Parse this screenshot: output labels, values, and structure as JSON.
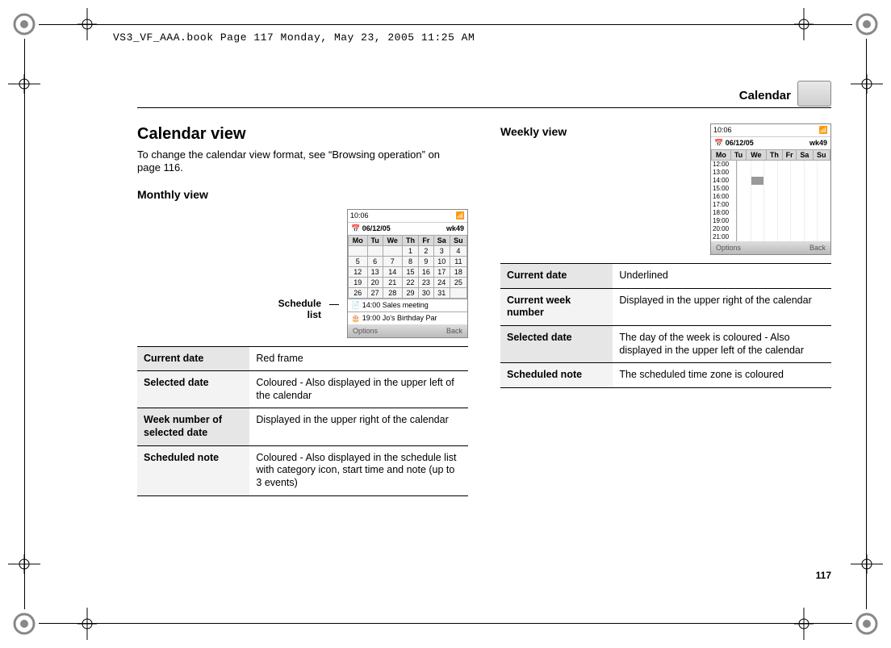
{
  "header_line": "VS3_VF_AAA.book  Page 117  Monday, May 23, 2005  11:25 AM",
  "running_head": "Calendar",
  "page_number": "117",
  "left": {
    "h2": "Calendar view",
    "intro": "To change the calendar view format, see “Browsing operation” on page 116.",
    "h3": "Monthly view",
    "callout": "Schedule\nlist",
    "phone": {
      "clock": "10:06",
      "date": "06/12/05",
      "week": "wk49",
      "days": [
        "Mo",
        "Tu",
        "We",
        "Th",
        "Fr",
        "Sa",
        "Su"
      ],
      "grid": [
        [
          "",
          "",
          "",
          "1",
          "2",
          "3",
          "4"
        ],
        [
          "5",
          "6",
          "7",
          "8",
          "9",
          "10",
          "11"
        ],
        [
          "12",
          "13",
          "14",
          "15",
          "16",
          "17",
          "18"
        ],
        [
          "19",
          "20",
          "21",
          "22",
          "23",
          "24",
          "25"
        ],
        [
          "26",
          "27",
          "28",
          "29",
          "30",
          "31",
          ""
        ]
      ],
      "sched1": "14:00  Sales meeting",
      "sched2": "19:00  Jo's Birthday Par",
      "soft_left": "Options",
      "soft_right": "Back"
    },
    "table": [
      {
        "label": "Current date",
        "value": "Red frame"
      },
      {
        "label": "Selected date",
        "value": "Coloured - Also displayed in the upper left of the calendar"
      },
      {
        "label": "Week number of selected date",
        "value": "Displayed in the upper right of the calendar"
      },
      {
        "label": "Scheduled note",
        "value": "Coloured - Also displayed in the schedule list with category icon, start time and note (up to 3 events)"
      }
    ]
  },
  "right": {
    "h3": "Weekly view",
    "phone": {
      "clock": "10:06",
      "date": "06/12/05",
      "week": "wk49",
      "days": [
        "Mo",
        "Tu",
        "We",
        "Th",
        "Fr",
        "Sa",
        "Su"
      ],
      "hours": [
        "12:00",
        "13:00",
        "14:00",
        "15:00",
        "16:00",
        "17:00",
        "18:00",
        "19:00",
        "20:00",
        "21:00"
      ],
      "soft_left": "Options",
      "soft_right": "Back"
    },
    "table": [
      {
        "label": "Current date",
        "value": "Underlined"
      },
      {
        "label": "Current week number",
        "value": "Displayed in the upper right of the calendar"
      },
      {
        "label": "Selected date",
        "value": "The day of the week is coloured - Also displayed in the upper left of the calendar"
      },
      {
        "label": "Scheduled note",
        "value": "The scheduled time zone is coloured"
      }
    ]
  }
}
